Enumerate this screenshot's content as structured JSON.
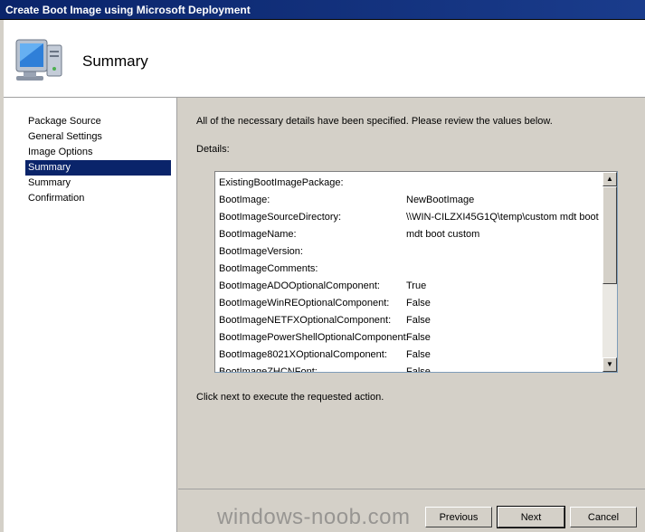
{
  "window": {
    "title": "Create Boot Image using Microsoft Deployment"
  },
  "header": {
    "title": "Summary",
    "icon": "computer-monitor-icon"
  },
  "nav": {
    "items": [
      {
        "label": "Package Source",
        "active": false
      },
      {
        "label": "General Settings",
        "active": false
      },
      {
        "label": "Image Options",
        "active": false
      },
      {
        "label": "Summary",
        "active": true
      },
      {
        "label": "Summary",
        "active": false
      },
      {
        "label": "Confirmation",
        "active": false
      }
    ]
  },
  "content": {
    "intro": "All of the necessary details have been specified.  Please review the values below.",
    "details_label": "Details:",
    "rows": [
      {
        "key": "ExistingBootImagePackage:",
        "value": ""
      },
      {
        "key": "BootImage:",
        "value": "NewBootImage"
      },
      {
        "key": "BootImageSourceDirectory:",
        "value": "\\\\WIN-CILZXI45G1Q\\temp\\custom mdt boot"
      },
      {
        "key": "BootImageName:",
        "value": "mdt boot custom"
      },
      {
        "key": "BootImageVersion:",
        "value": ""
      },
      {
        "key": "BootImageComments:",
        "value": ""
      },
      {
        "key": "BootImageADOOptionalComponent:",
        "value": "True"
      },
      {
        "key": "BootImageWinREOptionalComponent:",
        "value": "False"
      },
      {
        "key": "BootImageNETFXOptionalComponent:",
        "value": "False"
      },
      {
        "key": "BootImagePowerShellOptionalComponent:",
        "value": "False"
      },
      {
        "key": "BootImage8021XOptionalComponent:",
        "value": "False"
      },
      {
        "key": "BootImageZHCNFont:",
        "value": "False"
      }
    ],
    "next_message": "Click next to execute the requested action."
  },
  "footer": {
    "previous_label": "Previous",
    "next_label": "Next",
    "cancel_label": "Cancel"
  },
  "watermark": "windows-noob.com",
  "colors": {
    "titlebar": "#0a246a",
    "selection": "#0a246a",
    "face": "#d4d0c8"
  }
}
